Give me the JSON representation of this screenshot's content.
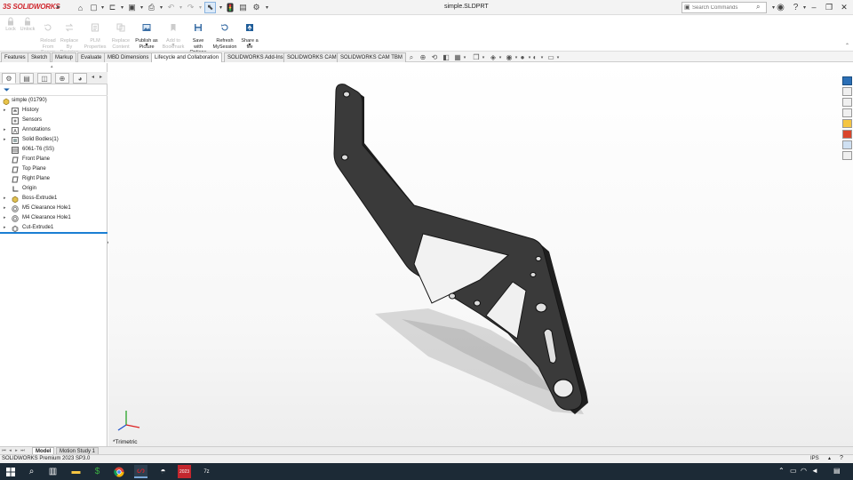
{
  "app": {
    "brand_prefix": "3S",
    "brand": "SOLIDWORKS",
    "document_title": "simple.SLDPRT"
  },
  "quick_access": {
    "icons": [
      "home-icon",
      "new-icon",
      "open-icon",
      "save-icon",
      "print-icon",
      "undo-icon",
      "redo-icon",
      "select-icon",
      "traffic-light-icon",
      "file-properties-icon",
      "options-icon"
    ]
  },
  "search": {
    "placeholder": "Search Commands"
  },
  "command_manager": {
    "commands": [
      {
        "label": "Lock",
        "enabled": false
      },
      {
        "label": "Unlock",
        "enabled": false
      },
      {
        "label": "Reload\nFrom\nServer",
        "enabled": false
      },
      {
        "label": "Replace\nBy\nRevision",
        "enabled": false
      },
      {
        "label": "PLM\nProperties",
        "enabled": false
      },
      {
        "label": "Replace\nContent",
        "enabled": false
      },
      {
        "label": "Publish as\nPicture",
        "enabled": true
      },
      {
        "label": "Add to\nBookmark",
        "enabled": false
      },
      {
        "label": "Save\nwith\nOptions",
        "enabled": true
      },
      {
        "label": "Refresh\nMySession",
        "enabled": true
      },
      {
        "label": "Share a\nfile",
        "enabled": true
      }
    ]
  },
  "tabs": [
    {
      "label": "Features",
      "active": false
    },
    {
      "label": "Sketch",
      "active": false
    },
    {
      "label": "Markup",
      "active": false
    },
    {
      "label": "Evaluate",
      "active": false
    },
    {
      "label": "MBD Dimensions",
      "active": false
    },
    {
      "label": "Lifecycle and Collaboration",
      "active": true
    },
    {
      "label": "SOLIDWORKS Add-Ins",
      "active": false
    },
    {
      "label": "SOLIDWORKS CAM",
      "active": false
    },
    {
      "label": "SOLIDWORKS CAM TBM",
      "active": false
    }
  ],
  "feature_tree": {
    "root": "simple  (01790)",
    "items": [
      {
        "label": "History",
        "expandable": true,
        "icon": "history-icon"
      },
      {
        "label": "Sensors",
        "expandable": false,
        "icon": "sensors-icon"
      },
      {
        "label": "Annotations",
        "expandable": true,
        "icon": "annotations-icon"
      },
      {
        "label": "Solid Bodies(1)",
        "expandable": true,
        "icon": "solid-bodies-icon"
      },
      {
        "label": "6061-T6 (SS)",
        "expandable": false,
        "icon": "material-icon"
      },
      {
        "label": "Front Plane",
        "expandable": false,
        "icon": "plane-icon"
      },
      {
        "label": "Top Plane",
        "expandable": false,
        "icon": "plane-icon"
      },
      {
        "label": "Right Plane",
        "expandable": false,
        "icon": "plane-icon"
      },
      {
        "label": "Origin",
        "expandable": false,
        "icon": "origin-icon"
      },
      {
        "label": "Boss-Extrude1",
        "expandable": true,
        "icon": "extrude-icon"
      },
      {
        "label": "M5 Clearance Hole1",
        "expandable": true,
        "icon": "hole-icon"
      },
      {
        "label": "M4 Clearance Hole1",
        "expandable": true,
        "icon": "hole-icon"
      },
      {
        "label": "Cut-Extrude1",
        "expandable": true,
        "icon": "cut-extrude-icon"
      }
    ]
  },
  "viewport": {
    "view_label": "*Trimetric"
  },
  "bottom_tabs": [
    {
      "label": "Model",
      "active": true
    },
    {
      "label": "Motion Study 1",
      "active": false
    }
  ],
  "status": {
    "text": "SOLIDWORKS Premium 2023 SP3.0",
    "units": "IPS"
  },
  "colors": {
    "brand_red": "#d0262d",
    "part_gray": "#3a3a3a",
    "taskbar": "#1c2a36",
    "tree_selection": "#1b7fd3"
  }
}
